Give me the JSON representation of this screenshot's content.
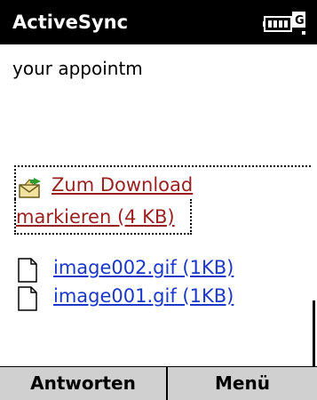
{
  "app": {
    "title": "ActiveSync",
    "battery_icon": "battery-icon"
  },
  "message": {
    "body_text": "your appointm"
  },
  "attachment_download": {
    "icon": "download-icon",
    "line1": "Zum Download",
    "line2": "markieren (4 KB)",
    "link_color": "#9a1f1f"
  },
  "files": [
    {
      "name": "image002.gif (1KB)",
      "icon": "file-icon"
    },
    {
      "name": "image001.gif (1KB)",
      "icon": "file-icon"
    }
  ],
  "file_link_color": "#1a37c9",
  "softkeys": {
    "left": "Antworten",
    "right": "Menü"
  }
}
